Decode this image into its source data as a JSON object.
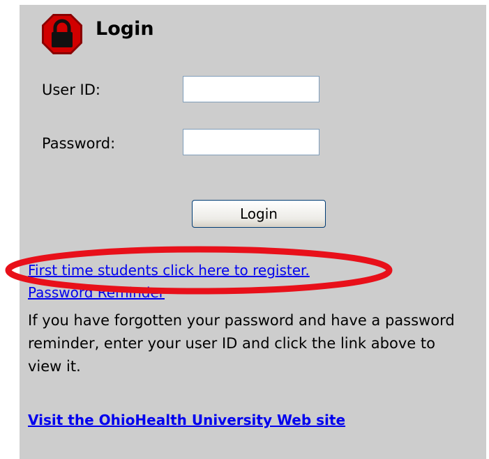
{
  "header": {
    "title": "Login",
    "icon": "stop-lock-icon",
    "icon_color": "#c00000"
  },
  "form": {
    "userid_label": "User ID:",
    "userid_value": "",
    "password_label": "Password:",
    "password_value": "",
    "submit_label": "Login"
  },
  "links": {
    "register": "First time students click here to register.",
    "reminder": "Password Reminder",
    "site": "Visit the OhioHealth University Web site"
  },
  "help_text": "If you have forgotten your password and have a password reminder, enter your user ID and click the link above to view it.",
  "annotation": {
    "highlight_color": "#e8101a"
  }
}
